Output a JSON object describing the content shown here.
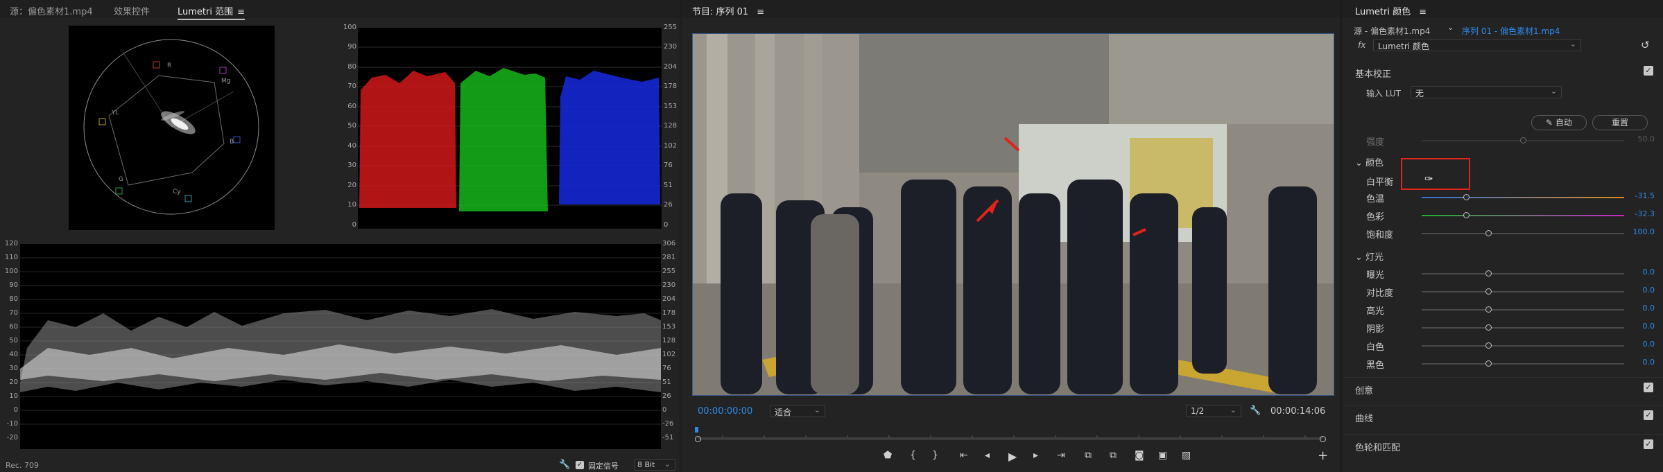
{
  "left_panel": {
    "tabs": [
      {
        "label": "源：偏色素材1.mp4"
      },
      {
        "label": "效果控件"
      },
      {
        "label": "Lumetri 范围"
      }
    ],
    "vectorscope_labels": [
      "R",
      "Mg",
      "B",
      "Cy",
      "G",
      "YL"
    ],
    "histogram_left_scale": [
      "100",
      "90",
      "80",
      "70",
      "60",
      "50",
      "40",
      "30",
      "20",
      "10",
      "0"
    ],
    "histogram_right_scale": [
      "255",
      "230",
      "204",
      "178",
      "153",
      "128",
      "102",
      "76",
      "51",
      "26",
      "0"
    ],
    "waveform_left_scale": [
      "120",
      "110",
      "100",
      "90",
      "80",
      "70",
      "60",
      "50",
      "40",
      "30",
      "20",
      "10",
      "0",
      "-10",
      "-20"
    ],
    "waveform_right_scale": [
      "306",
      "281",
      "255",
      "230",
      "204",
      "178",
      "153",
      "128",
      "102",
      "76",
      "51",
      "26",
      "0",
      "-26",
      "-51"
    ],
    "footer": {
      "left": "Rec. 709",
      "clamp_label": "固定信号",
      "bit_depth": "8 Bit"
    }
  },
  "program_monitor": {
    "title": "节目: 序列 01",
    "timecode_current": "00:00:00:00",
    "zoom": "适合",
    "resolution": "1/2",
    "timecode_duration": "00:00:14:06",
    "controls": [
      "marker-icon",
      "in-point-icon",
      "out-point-icon",
      "go-to-in-icon",
      "step-back-icon",
      "play-icon",
      "step-forward-icon",
      "go-to-out-icon",
      "lift-icon",
      "extract-icon",
      "camera-icon",
      "multi-camera-icon",
      "comparison-icon",
      "add-icon"
    ]
  },
  "lumetri_color": {
    "title": "Lumetri 颜色",
    "source_label": "源 - 偏色素材1.mp4",
    "sequence_label": "序列 01 - 偏色素材1.mp4",
    "fx_label": "fx",
    "effect_name": "Lumetri 颜色",
    "basic_section": "基本校正",
    "input_lut_label": "输入 LUT",
    "input_lut_value": "无",
    "auto_button": "自动",
    "reset_button": "重置",
    "intensity_label": "强度",
    "intensity_value": "50.0",
    "color_group": "颜色",
    "white_balance_label": "白平衡",
    "temperature_label": "色温",
    "temperature_value": "-31.5",
    "tint_label": "色彩",
    "tint_value": "-32.3",
    "saturation_label": "饱和度",
    "saturation_value": "100.0",
    "light_group": "灯光",
    "light_rows": [
      {
        "label": "曝光",
        "value": "0.0"
      },
      {
        "label": "对比度",
        "value": "0.0"
      },
      {
        "label": "高光",
        "value": "0.0"
      },
      {
        "label": "阴影",
        "value": "0.0"
      },
      {
        "label": "白色",
        "value": "0.0"
      },
      {
        "label": "黑色",
        "value": "0.0"
      }
    ],
    "sections": [
      "创意",
      "曲线",
      "色轮和匹配"
    ],
    "accent_color": "#2d8ceb",
    "highlight_color": "#e0231b"
  }
}
